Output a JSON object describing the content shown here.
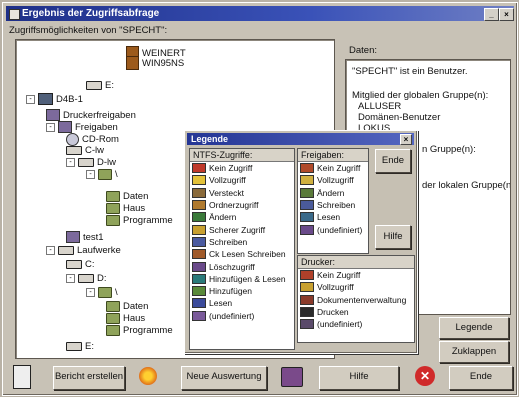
{
  "window": {
    "title": "Ergebnis der Zugriffsabfrage"
  },
  "left_group_label": "Zugriffsmöglichkeiten von \"SPECHT\":",
  "right_group_label": "Daten:",
  "tree": [
    {
      "label": "WEINERT",
      "icon": "server-icon",
      "depth": 5,
      "expand": ""
    },
    {
      "label": "WIN95NS",
      "icon": "server-icon",
      "depth": 5,
      "expand": ""
    },
    {
      "label": "E:",
      "icon": "drive-icon",
      "depth": 3,
      "expand": ""
    },
    {
      "label": "D4B-1",
      "icon": "computer-icon",
      "depth": 0,
      "expand": "⊟"
    },
    {
      "label": "Druckerfreigaben",
      "icon": "share-icon",
      "depth": 1,
      "expand": ""
    },
    {
      "label": "Freigaben",
      "icon": "share-icon",
      "depth": 1,
      "expand": "⊟"
    },
    {
      "label": "CD-Rom",
      "icon": "cd-icon",
      "depth": 2,
      "expand": ""
    },
    {
      "label": "C-lw",
      "icon": "drive-icon",
      "depth": 2,
      "expand": ""
    },
    {
      "label": "D-lw",
      "icon": "drive-icon",
      "depth": 2,
      "expand": "⊟"
    },
    {
      "label": "\\",
      "icon": "folder-icon",
      "depth": 3,
      "expand": "⊟"
    },
    {
      "label": "Daten",
      "icon": "folder-icon",
      "depth": 4,
      "expand": ""
    },
    {
      "label": "Haus",
      "icon": "folder-icon",
      "depth": 4,
      "expand": ""
    },
    {
      "label": "Programme",
      "icon": "folder-icon",
      "depth": 4,
      "expand": ""
    },
    {
      "label": "test1",
      "icon": "share-icon",
      "depth": 2,
      "expand": ""
    },
    {
      "label": "Laufwerke",
      "icon": "drive-icon",
      "depth": 1,
      "expand": "⊟"
    },
    {
      "label": "C:",
      "icon": "drive-icon",
      "depth": 2,
      "expand": ""
    },
    {
      "label": "D:",
      "icon": "drive-icon",
      "depth": 2,
      "expand": "⊟"
    },
    {
      "label": "\\",
      "icon": "folder-icon",
      "depth": 3,
      "expand": "⊟"
    },
    {
      "label": "Daten",
      "icon": "folder-icon",
      "depth": 4,
      "expand": ""
    },
    {
      "label": "Haus",
      "icon": "folder-icon",
      "depth": 4,
      "expand": ""
    },
    {
      "label": "Programme",
      "icon": "folder-icon",
      "depth": 4,
      "expand": ""
    },
    {
      "label": "E:",
      "icon": "drive-icon",
      "depth": 2,
      "expand": ""
    }
  ],
  "info": {
    "line1": "\"SPECHT\" ist ein Benutzer.",
    "line2": "Mitglied der globalen Gruppe(n):",
    "line3": "ALLUSER",
    "line4": "Domänen-Benutzer",
    "line5": "LOKUS",
    "line6": "n Gruppe(n):",
    "line7": "der lokalen Gruppe(n):"
  },
  "legend": {
    "title": "Legende",
    "ntfs_header": "NTFS-Zugriffe:",
    "ntfs_items": [
      {
        "label": "Kein Zugriff",
        "color": "#c0392b"
      },
      {
        "label": "Vollzugriff",
        "color": "#e3c23a"
      },
      {
        "label": "Versteckt",
        "color": "#8a6a3a"
      },
      {
        "label": "Ordnerzugriff",
        "color": "#b07a2e"
      },
      {
        "label": "Ändern",
        "color": "#3a7a3a"
      },
      {
        "label": "Scherer Zugriff",
        "color": "#c8a030"
      },
      {
        "label": "Schreiben",
        "color": "#4a5aa0"
      },
      {
        "label": "Ck Lesen Schreiben",
        "color": "#a05a2a"
      },
      {
        "label": "Löschzugriff",
        "color": "#6a4a8a"
      },
      {
        "label": "Hinzufügen & Lesen",
        "color": "#2a7a7a"
      },
      {
        "label": "Hinzufügen",
        "color": "#5a8a3a"
      },
      {
        "label": "Lesen",
        "color": "#3a4a9a"
      },
      {
        "label": "(undefiniert)",
        "color": "#7a5a9a"
      }
    ],
    "share_header": "Freigaben:",
    "share_items": [
      {
        "label": "Kein Zugriff",
        "color": "#b04a2a"
      },
      {
        "label": "Vollzugriff",
        "color": "#d0b040"
      },
      {
        "label": "Ändern",
        "color": "#5a7a3a"
      },
      {
        "label": "Schreiben",
        "color": "#4a5a9a"
      },
      {
        "label": "Lesen",
        "color": "#3a6a8a"
      },
      {
        "label": "(undefiniert)",
        "color": "#6a4a8a"
      }
    ],
    "printer_header": "Drucker:",
    "printer_items": [
      {
        "label": "Kein Zugriff",
        "color": "#b0402a"
      },
      {
        "label": "Vollzugriff",
        "color": "#c8a030"
      },
      {
        "label": "Dokumentenverwaltung",
        "color": "#8a3a2a"
      },
      {
        "label": "Drucken",
        "color": "#2a2a2a"
      },
      {
        "label": "(undefiniert)",
        "color": "#5a4a6a"
      }
    ],
    "end_label": "Ende",
    "help_label": "Hilfe"
  },
  "side_buttons": {
    "legend": "Legende",
    "collapse": "Zuklappen"
  },
  "bottom": {
    "report": "Bericht erstellen",
    "new_eval": "Neue Auswertung",
    "help": "Hilfe",
    "end": "Ende"
  }
}
